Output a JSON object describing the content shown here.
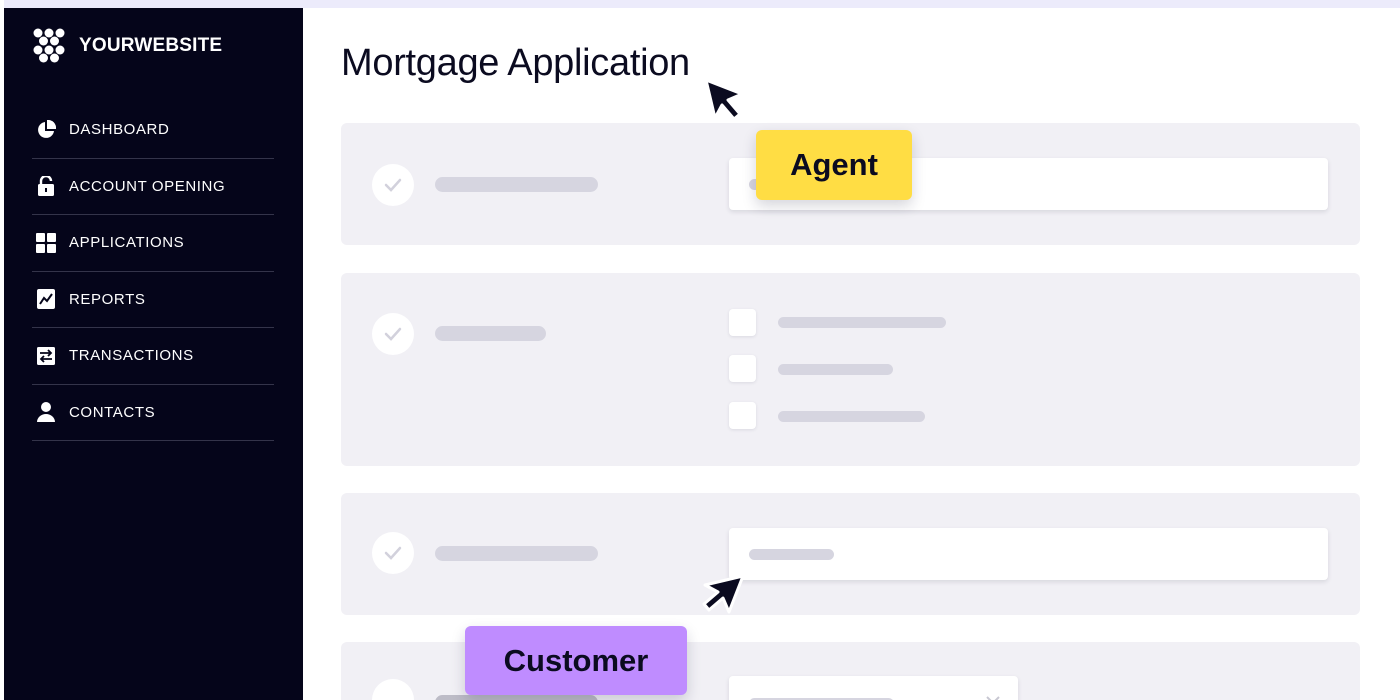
{
  "sidebar": {
    "brand": "YOURWEBSITE",
    "items": [
      {
        "label": "DASHBOARD",
        "icon": "pie-chart-icon"
      },
      {
        "label": "ACCOUNT OPENING",
        "icon": "unlock-icon"
      },
      {
        "label": "APPLICATIONS",
        "icon": "grid-icon"
      },
      {
        "label": "REPORTS",
        "icon": "chart-file-icon"
      },
      {
        "label": "TRANSACTIONS",
        "icon": "exchange-icon"
      },
      {
        "label": "CONTACTS",
        "icon": "user-icon"
      }
    ]
  },
  "main": {
    "title": "Mortgage Application"
  },
  "labels": {
    "agent": "Agent",
    "customer": "Customer"
  },
  "colors": {
    "sidebar_bg": "#05051a",
    "agent_tag": "#ffdd44",
    "customer_tag": "#bf8cff",
    "section_bg": "#f1f0f5",
    "placeholder_bar": "#d6d5e0"
  }
}
